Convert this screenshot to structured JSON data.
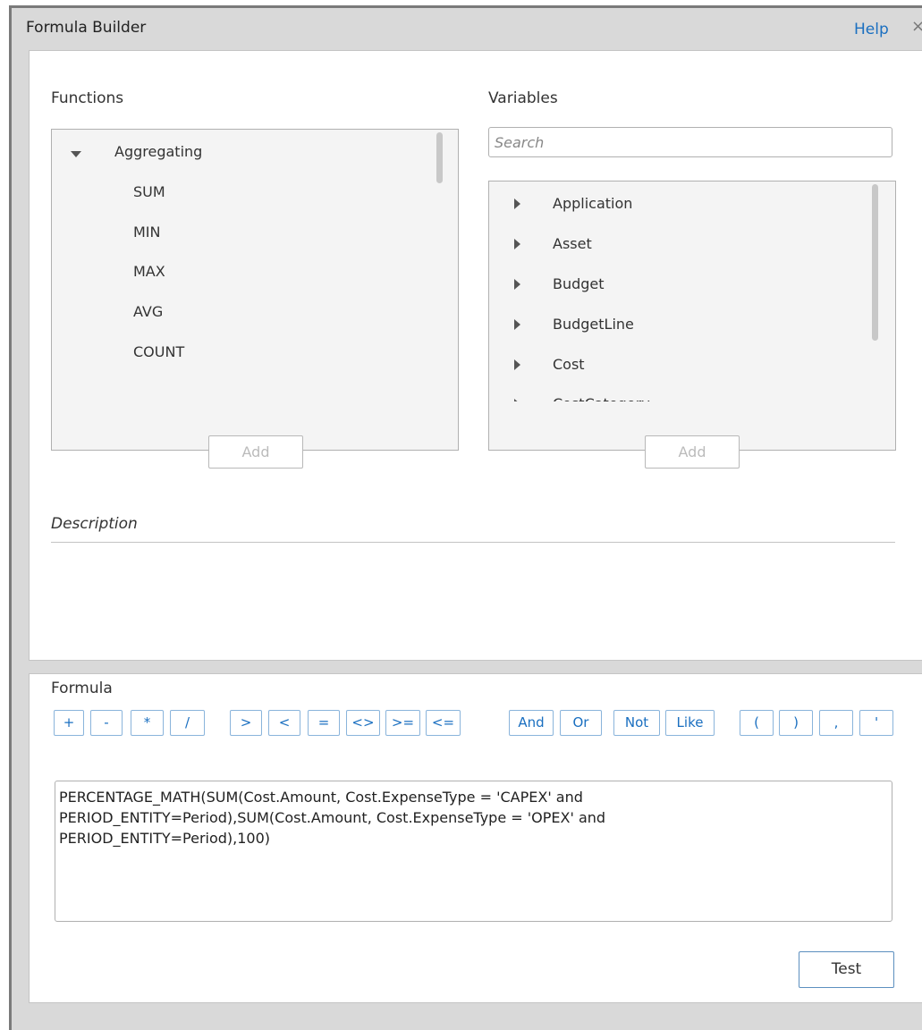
{
  "window": {
    "title": "Formula Builder",
    "help_label": "Help",
    "close_glyph": "×"
  },
  "functions": {
    "label": "Functions",
    "group": "Aggregating",
    "items": [
      "SUM",
      "MIN",
      "MAX",
      "AVG",
      "COUNT"
    ],
    "add_label": "Add"
  },
  "variables": {
    "label": "Variables",
    "search_placeholder": "Search",
    "items": [
      "Application",
      "Asset",
      "Budget",
      "BudgetLine",
      "Cost",
      "CostCategory"
    ],
    "add_label": "Add"
  },
  "description": {
    "label": "Description"
  },
  "formula": {
    "label": "Formula",
    "operators": [
      "+",
      "-",
      "*",
      "/",
      ">",
      "<",
      "=",
      "<>",
      ">=",
      "<=",
      "And",
      "Or",
      "Not",
      "Like",
      "(",
      ")",
      ",",
      "'"
    ],
    "value": "PERCENTAGE_MATH(SUM(Cost.Amount, Cost.ExpenseType = 'CAPEX' and\nPERIOD_ENTITY=Period),SUM(Cost.Amount, Cost.ExpenseType = 'OPEX' and\nPERIOD_ENTITY=Period),100)",
    "test_label": "Test"
  },
  "colors": {
    "link": "#1a6fc0",
    "panel_bg": "#ffffff",
    "dialog_bg": "#d9d9d9",
    "list_bg": "#f4f4f4"
  }
}
